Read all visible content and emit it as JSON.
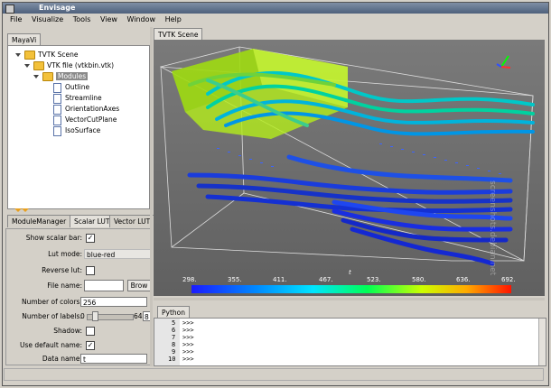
{
  "window": {
    "title": "Envisage"
  },
  "menu": [
    "File",
    "Visualize",
    "Tools",
    "View",
    "Window",
    "Help"
  ],
  "left_tab": "MayaVi",
  "tree": {
    "root": "TVTK Scene",
    "file": "VTK file (vtkbin.vtk)",
    "modules_label": "Modules",
    "modules": [
      "Outline",
      "Streamline",
      "OrientationAxes",
      "VectorCutPlane",
      "IsoSurface"
    ]
  },
  "bottom_tabs": [
    "ModuleManager",
    "Scalar LUT",
    "Vector LUT"
  ],
  "lut_form": {
    "show_scalar_bar": "Show scalar bar:",
    "lut_mode": "Lut mode:",
    "lut_mode_value": "blue-red",
    "reverse_lut": "Reverse lut:",
    "file_name": "File name:",
    "file_name_value": "",
    "browse": "Brow",
    "number_of_colors": "Number of colors:",
    "number_of_colors_value": "256",
    "number_of_labels": "Number of labels:",
    "labels_min": "0",
    "labels_max": "64",
    "labels_value": "8",
    "labels_fraction": 0.125,
    "shadow": "Shadow:",
    "use_default_name": "Use default name:",
    "data_name": "Data name:",
    "data_name_value": "t",
    "checkmark": "✓"
  },
  "scene_tab": "TVTK Scene",
  "scalar_bar": {
    "labels": [
      "298.",
      "355.",
      "411.",
      "467.",
      "523.",
      "580.",
      "636.",
      "692."
    ],
    "title": "t"
  },
  "python": {
    "tab": "Python",
    "line_numbers": [
      "5",
      "6",
      "7",
      "8",
      "9",
      "10"
    ],
    "prompt": ">>>"
  },
  "colors": {
    "lut_blue": "#1a2cff",
    "lut_red": "#ff1a00",
    "isosurface": "#b7f01a"
  },
  "watermark": "screenshots.debian.net"
}
